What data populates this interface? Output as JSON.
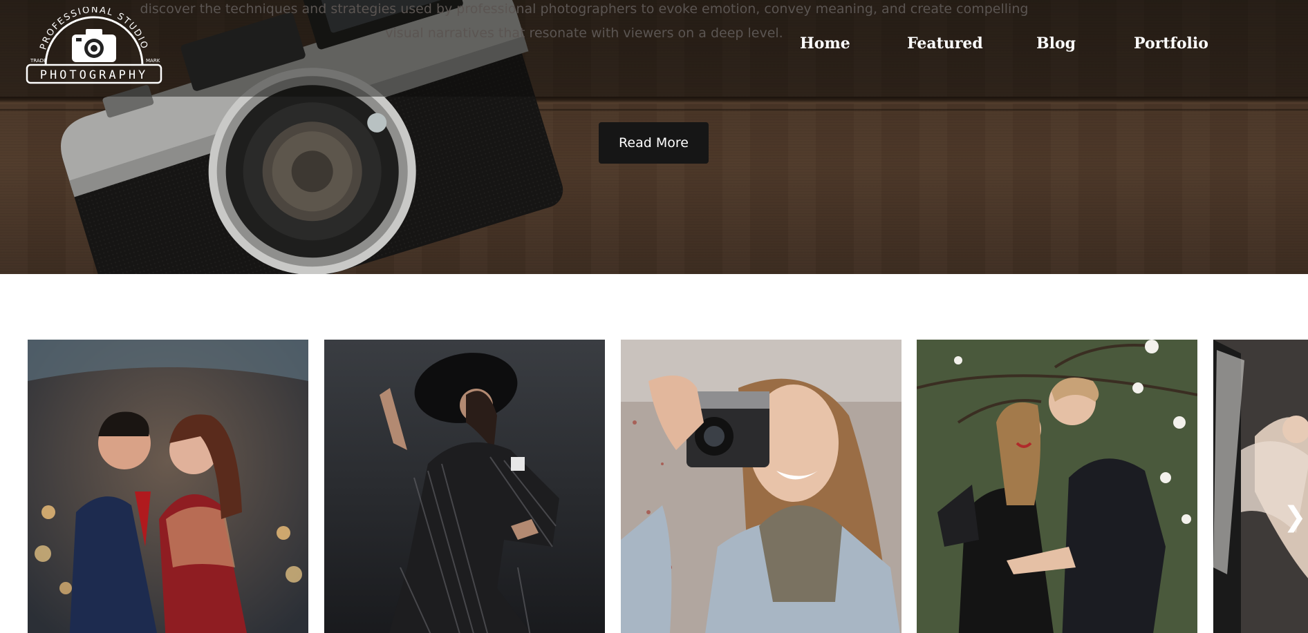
{
  "hero": {
    "description": "discover the techniques and strategies used by professional photographers to evoke emotion, convey meaning, and create compelling visual narratives that resonate with viewers on a deep level.",
    "cta_label": "Read More"
  },
  "logo": {
    "arc_text": "PROFESSIONAL STUDIO",
    "main_text": "PHOTOGRAPHY",
    "left_small": "TRADE",
    "right_small": "MARK",
    "icon": "camera-icon"
  },
  "nav": {
    "items": [
      {
        "label": "Home"
      },
      {
        "label": "Featured"
      },
      {
        "label": "Blog"
      },
      {
        "label": "Portfolio"
      }
    ]
  },
  "gallery": {
    "cards": [
      {
        "subject": "wedding-couple-photo"
      },
      {
        "subject": "fashion-hat-model-photo"
      },
      {
        "subject": "woman-with-camera-photo"
      },
      {
        "subject": "couple-under-blossom-photo"
      },
      {
        "subject": "tulle-dress-photo"
      }
    ],
    "next_icon": "chevron-right-icon",
    "next_glyph": "❯"
  },
  "colors": {
    "button_bg": "#161616",
    "nav_text": "#ffffff",
    "hero_wood": "#4a3627"
  }
}
